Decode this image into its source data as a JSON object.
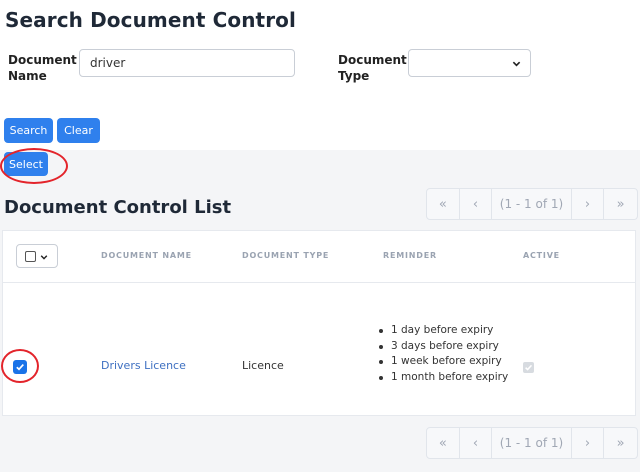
{
  "page": {
    "title": "Search Document Control"
  },
  "search_form": {
    "document_name_label": "Document\nName",
    "document_name_value": "driver",
    "document_type_label": "Document\nType",
    "document_type_value": ""
  },
  "buttons": {
    "search": "Search",
    "clear": "Clear",
    "select": "Select"
  },
  "list": {
    "title": "Document Control List",
    "columns": [
      "DOCUMENT NAME",
      "DOCUMENT TYPE",
      "REMINDER",
      "ACTIVE"
    ],
    "rows": [
      {
        "selected": true,
        "document_name": "Drivers Licence",
        "document_type": "Licence",
        "reminders": [
          "1 day before expiry",
          "3 days before expiry",
          "1 week before expiry",
          "1 month before expiry"
        ],
        "active": true
      }
    ]
  },
  "pagination": {
    "first": "«",
    "prev": "‹",
    "info": "(1 - 1 of 1)",
    "next": "›",
    "last": "»"
  },
  "colors": {
    "primary": "#2f80ed",
    "annotation": "#e3242b",
    "link": "#3d6fc1"
  }
}
